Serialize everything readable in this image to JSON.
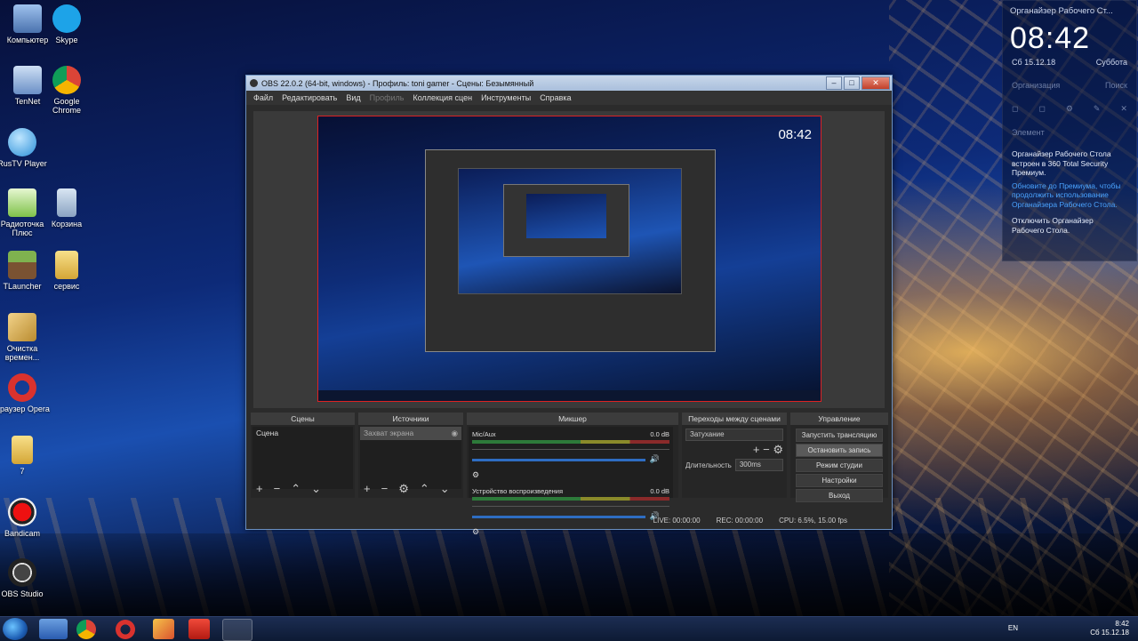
{
  "desktop": {
    "icons": [
      {
        "label": "Компьютер",
        "color": "#6c94c8"
      },
      {
        "label": "Skype",
        "color": "#1da3e8"
      },
      {
        "label": "TenNet",
        "color": "#7ea4d6"
      },
      {
        "label": "Google Chrome",
        "color": "#e3b43c"
      },
      {
        "label": "RusTV Player",
        "color": "#43a4e6"
      },
      {
        "label": "Радиоточка Плюс",
        "color": "#8fd14f"
      },
      {
        "label": "Корзина",
        "color": "#9fb4cf"
      },
      {
        "label": "TLauncher",
        "color": "#5b8c3a"
      },
      {
        "label": "сервис",
        "color": "#e9c659"
      },
      {
        "label": "Очистка времен...",
        "color": "#d9b25a"
      },
      {
        "label": "Браузер Opera",
        "color": "#d9322e"
      },
      {
        "label": "7",
        "color": "#e9c659"
      },
      {
        "label": "Bandicam",
        "color": "#d7261e"
      },
      {
        "label": "OBS Studio",
        "color": "#3a3a3a"
      }
    ]
  },
  "widget": {
    "title": "Органайзер Рабочего Ст...",
    "time": "08:42",
    "date": "Сб 15.12.18",
    "weekday": "Суббота",
    "tab_organizer": "Организация",
    "tab_search": "Поиск",
    "element_label": "Элемент",
    "message": "Органайзер Рабочего Стола встроен в 360 Total Security Премиум.",
    "link": "Обновите до Премиума, чтобы продолжить использование Органайзера Рабочего Стола.",
    "disable": "Отключить Органайзер Рабочего Стола."
  },
  "obs": {
    "title": "OBS 22.0.2 (64-bit, windows) - Профиль: toni gamer - Сцены: Безымянный",
    "menu": [
      "Файл",
      "Редактировать",
      "Вид",
      "Профиль",
      "Коллекция сцен",
      "Инструменты",
      "Справка"
    ],
    "preview": {
      "clock": "08:42"
    },
    "docks": {
      "scenes": {
        "title": "Сцены",
        "items": [
          "Сцена"
        ]
      },
      "sources": {
        "title": "Источники",
        "items": [
          "Захват экрана"
        ]
      },
      "mixer": {
        "title": "Микшер",
        "channels": [
          {
            "name": "Mic/Aux",
            "level": "0.0 dB"
          },
          {
            "name": "Устройство воспроизведения",
            "level": "0.0 dB"
          }
        ]
      },
      "transitions": {
        "title": "Переходы между сценами",
        "type": "Затухание",
        "duration_label": "Длительность",
        "duration": "300ms"
      },
      "controls": {
        "title": "Управление",
        "buttons": [
          "Запустить трансляцию",
          "Остановить запись",
          "Режим студии",
          "Настройки",
          "Выход"
        ]
      }
    },
    "status": {
      "live": "LIVE: 00:00:00",
      "rec": "REC: 00:00:00",
      "cpu": "CPU: 6.5%, 15.00 fps"
    }
  },
  "taskbar": {
    "lang": "EN",
    "time": "8:42",
    "date": "Сб 15.12.18"
  }
}
